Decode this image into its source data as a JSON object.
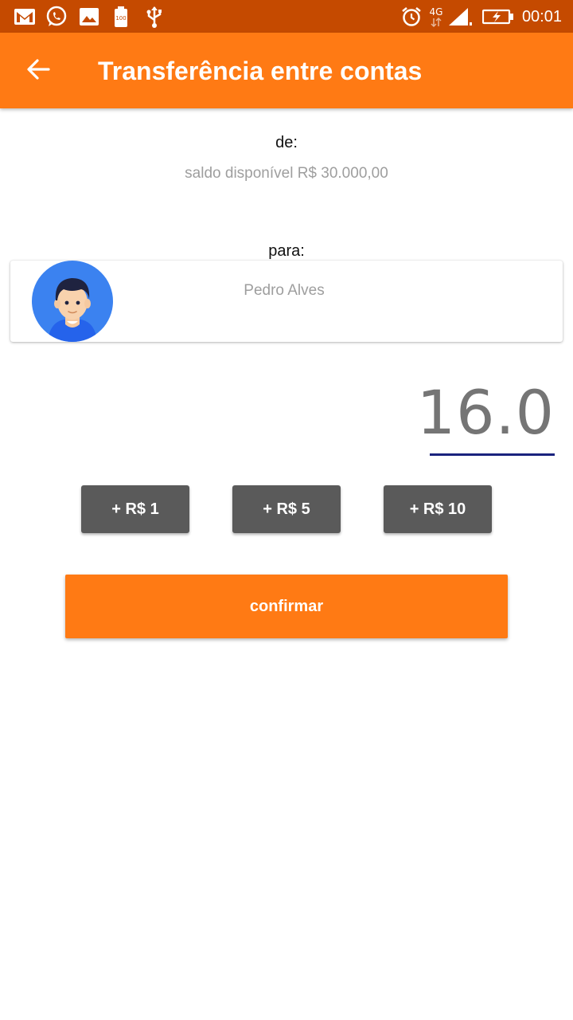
{
  "status_bar": {
    "time": "00:01",
    "network_label": "4G",
    "left_icons": [
      "gmail-icon",
      "whatsapp-icon",
      "gallery-icon",
      "battery-100-icon",
      "usb-icon"
    ],
    "right_icons": [
      "alarm-icon",
      "network-4g-icon",
      "signal-icon",
      "battery-charging-icon"
    ]
  },
  "app_bar": {
    "title": "Transferência entre contas",
    "back_icon": "arrow-left-icon",
    "background": "#ff7a14"
  },
  "from": {
    "label": "de:",
    "balance_text": "saldo disponível R$ 30.000,00"
  },
  "to": {
    "label": "para:",
    "recipient_name": "Pedro Alves",
    "avatar_icon": "user-avatar-icon"
  },
  "amount": {
    "value": "16.0"
  },
  "quick_add": [
    {
      "label": "+ R$ 1"
    },
    {
      "label": "+ R$ 5"
    },
    {
      "label": "+ R$ 10"
    }
  ],
  "confirm": {
    "label": "confirmar"
  },
  "colors": {
    "status_bar": "#c54a00",
    "accent": "#ff7a14",
    "chip": "#5a5a5a",
    "underline": "#1a237e",
    "muted_text": "#9e9e9e"
  }
}
